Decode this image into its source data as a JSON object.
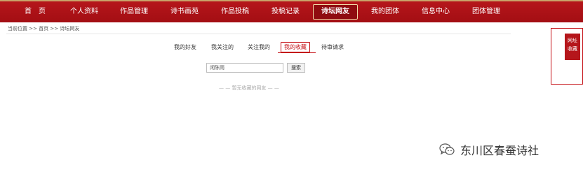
{
  "nav": {
    "items": [
      {
        "label": "首　页",
        "active": false
      },
      {
        "label": "个人资料",
        "active": false
      },
      {
        "label": "作品管理",
        "active": false
      },
      {
        "label": "诗书画苑",
        "active": false
      },
      {
        "label": "作品投稿",
        "active": false
      },
      {
        "label": "投稿记录",
        "active": false
      },
      {
        "label": "诗坛网友",
        "active": true
      },
      {
        "label": "我的团体",
        "active": false
      },
      {
        "label": "信息中心",
        "active": false
      },
      {
        "label": "团体管理",
        "active": false
      }
    ]
  },
  "breadcrumb": {
    "text": "当前位置 >> 首页 >> 诗坛网友"
  },
  "tabs": [
    {
      "label": "我的好友",
      "active": false
    },
    {
      "label": "我关注的",
      "active": false
    },
    {
      "label": "关注我的",
      "active": false
    },
    {
      "label": "我的收藏",
      "active": true
    },
    {
      "label": "待审请求",
      "active": false
    }
  ],
  "search": {
    "value": "闲陈雨",
    "button_label": "搜索"
  },
  "empty_note": "— — 暂无收藏的网友 — —",
  "side_tab": {
    "line1": "网址",
    "line2": "收藏"
  },
  "watermark": {
    "text": "东川区春蚕诗社",
    "icon": "wechat-icon"
  },
  "colors": {
    "nav_red": "#b5161b",
    "accent": "#c40d13"
  }
}
